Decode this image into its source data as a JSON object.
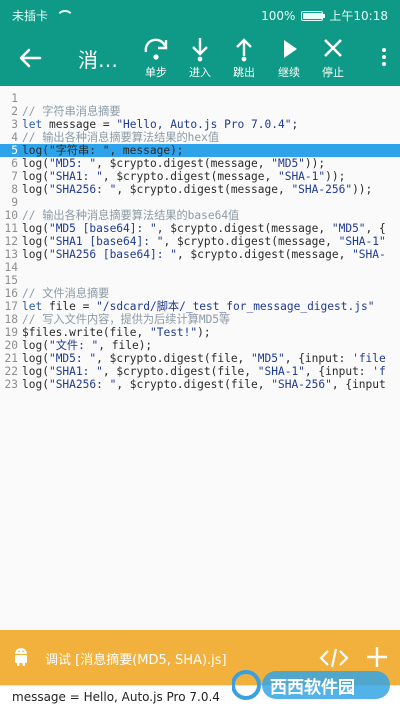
{
  "statusbar": {
    "carrier": "未插卡",
    "battery": "100%",
    "battery_level": 1.0,
    "time": "上午10:18"
  },
  "toolbar": {
    "title": "消…",
    "actions": [
      {
        "name": "step-over",
        "label": "单步",
        "icon": "step-icon"
      },
      {
        "name": "step-into",
        "label": "进入",
        "icon": "arrow-down-icon"
      },
      {
        "name": "step-out",
        "label": "跳出",
        "icon": "arrow-up-icon"
      },
      {
        "name": "continue",
        "label": "继续",
        "icon": "play-icon"
      },
      {
        "name": "stop",
        "label": "停止",
        "icon": "close-icon"
      }
    ]
  },
  "editor": {
    "active_line": 5,
    "lines": [
      {
        "n": "1",
        "parts": []
      },
      {
        "n": "2",
        "parts": [
          {
            "t": "// 字符串消息摘要",
            "c": "comment"
          }
        ]
      },
      {
        "n": "3",
        "parts": [
          {
            "t": "let ",
            "c": "kw"
          },
          {
            "t": "message = ",
            "c": "plain"
          },
          {
            "t": "\"Hello, Auto.js Pro 7.0.4\"",
            "c": "str"
          },
          {
            "t": ";",
            "c": "plain"
          }
        ]
      },
      {
        "n": "4",
        "parts": [
          {
            "t": "// 输出各种消息摘要算法结果的hex值",
            "c": "comment"
          }
        ]
      },
      {
        "n": "5",
        "parts": [
          {
            "t": "log(\"字符串: \", message);",
            "c": "plain"
          }
        ]
      },
      {
        "n": "6",
        "parts": [
          {
            "t": "log(",
            "c": "plain"
          },
          {
            "t": "\"MD5: \"",
            "c": "str"
          },
          {
            "t": ", $crypto.digest(message, ",
            "c": "plain"
          },
          {
            "t": "\"MD5\"",
            "c": "str"
          },
          {
            "t": "));",
            "c": "plain"
          }
        ]
      },
      {
        "n": "7",
        "parts": [
          {
            "t": "log(",
            "c": "plain"
          },
          {
            "t": "\"SHA1: \"",
            "c": "str"
          },
          {
            "t": ", $crypto.digest(message, ",
            "c": "plain"
          },
          {
            "t": "\"SHA-1\"",
            "c": "str"
          },
          {
            "t": "));",
            "c": "plain"
          }
        ]
      },
      {
        "n": "8",
        "parts": [
          {
            "t": "log(",
            "c": "plain"
          },
          {
            "t": "\"SHA256: \"",
            "c": "str"
          },
          {
            "t": ", $crypto.digest(message, ",
            "c": "plain"
          },
          {
            "t": "\"SHA-256\"",
            "c": "str"
          },
          {
            "t": "));",
            "c": "plain"
          }
        ]
      },
      {
        "n": "9",
        "parts": []
      },
      {
        "n": "10",
        "parts": [
          {
            "t": "// 输出各种消息摘要算法结果的base64值",
            "c": "comment"
          }
        ]
      },
      {
        "n": "11",
        "parts": [
          {
            "t": "log(",
            "c": "plain"
          },
          {
            "t": "\"MD5 [base64]: \"",
            "c": "str"
          },
          {
            "t": ", $crypto.digest(message, ",
            "c": "plain"
          },
          {
            "t": "\"MD5\"",
            "c": "str"
          },
          {
            "t": ", {",
            "c": "plain"
          }
        ]
      },
      {
        "n": "12",
        "parts": [
          {
            "t": "log(",
            "c": "plain"
          },
          {
            "t": "\"SHA1 [base64]: \"",
            "c": "str"
          },
          {
            "t": ", $crypto.digest(message, ",
            "c": "plain"
          },
          {
            "t": "\"SHA-1\"",
            "c": "str"
          }
        ]
      },
      {
        "n": "13",
        "parts": [
          {
            "t": "log(",
            "c": "plain"
          },
          {
            "t": "\"SHA256 [base64]: \"",
            "c": "str"
          },
          {
            "t": ", $crypto.digest(message, ",
            "c": "plain"
          },
          {
            "t": "\"SHA-",
            "c": "str"
          }
        ]
      },
      {
        "n": "14",
        "parts": []
      },
      {
        "n": "15",
        "parts": []
      },
      {
        "n": "16",
        "parts": [
          {
            "t": "// 文件消息摘要",
            "c": "comment"
          }
        ]
      },
      {
        "n": "17",
        "parts": [
          {
            "t": "let ",
            "c": "kw"
          },
          {
            "t": "file = ",
            "c": "plain"
          },
          {
            "t": "\"/sdcard/脚本/_test_for_message_digest.js\"",
            "c": "str"
          }
        ]
      },
      {
        "n": "18",
        "parts": [
          {
            "t": "// 写入文件内容，提供为后续计算MD5等",
            "c": "comment"
          }
        ]
      },
      {
        "n": "19",
        "parts": [
          {
            "t": "$files.write(file, ",
            "c": "plain"
          },
          {
            "t": "\"Test!\"",
            "c": "str"
          },
          {
            "t": ");",
            "c": "plain"
          }
        ]
      },
      {
        "n": "20",
        "parts": [
          {
            "t": "log(",
            "c": "plain"
          },
          {
            "t": "\"文件: \"",
            "c": "str"
          },
          {
            "t": ", file);",
            "c": "plain"
          }
        ]
      },
      {
        "n": "21",
        "parts": [
          {
            "t": "log(",
            "c": "plain"
          },
          {
            "t": "\"MD5: \"",
            "c": "str"
          },
          {
            "t": ", $crypto.digest(file, ",
            "c": "plain"
          },
          {
            "t": "\"MD5\"",
            "c": "str"
          },
          {
            "t": ", {input: ",
            "c": "plain"
          },
          {
            "t": "'file",
            "c": "str"
          }
        ]
      },
      {
        "n": "22",
        "parts": [
          {
            "t": "log(",
            "c": "plain"
          },
          {
            "t": "\"SHA1: \"",
            "c": "str"
          },
          {
            "t": ", $crypto.digest(file, ",
            "c": "plain"
          },
          {
            "t": "\"SHA-1\"",
            "c": "str"
          },
          {
            "t": ", {input: ",
            "c": "plain"
          },
          {
            "t": "'f",
            "c": "str"
          }
        ]
      },
      {
        "n": "23",
        "parts": [
          {
            "t": "log(",
            "c": "plain"
          },
          {
            "t": "\"SHA256: \"",
            "c": "str"
          },
          {
            "t": ", $crypto.digest(file, ",
            "c": "plain"
          },
          {
            "t": "\"SHA-256\"",
            "c": "str"
          },
          {
            "t": ", {input",
            "c": "plain"
          }
        ]
      }
    ]
  },
  "bottom": {
    "file_label": "调试 [消息摘要(MD5, SHA).js]",
    "console_output": "message = Hello, Auto.js Pro 7.0.4",
    "watermark": "西西软件园"
  },
  "colors": {
    "primary": "#0e9a86",
    "accent": "#f2b13c",
    "highlight": "#2fa3ea"
  }
}
